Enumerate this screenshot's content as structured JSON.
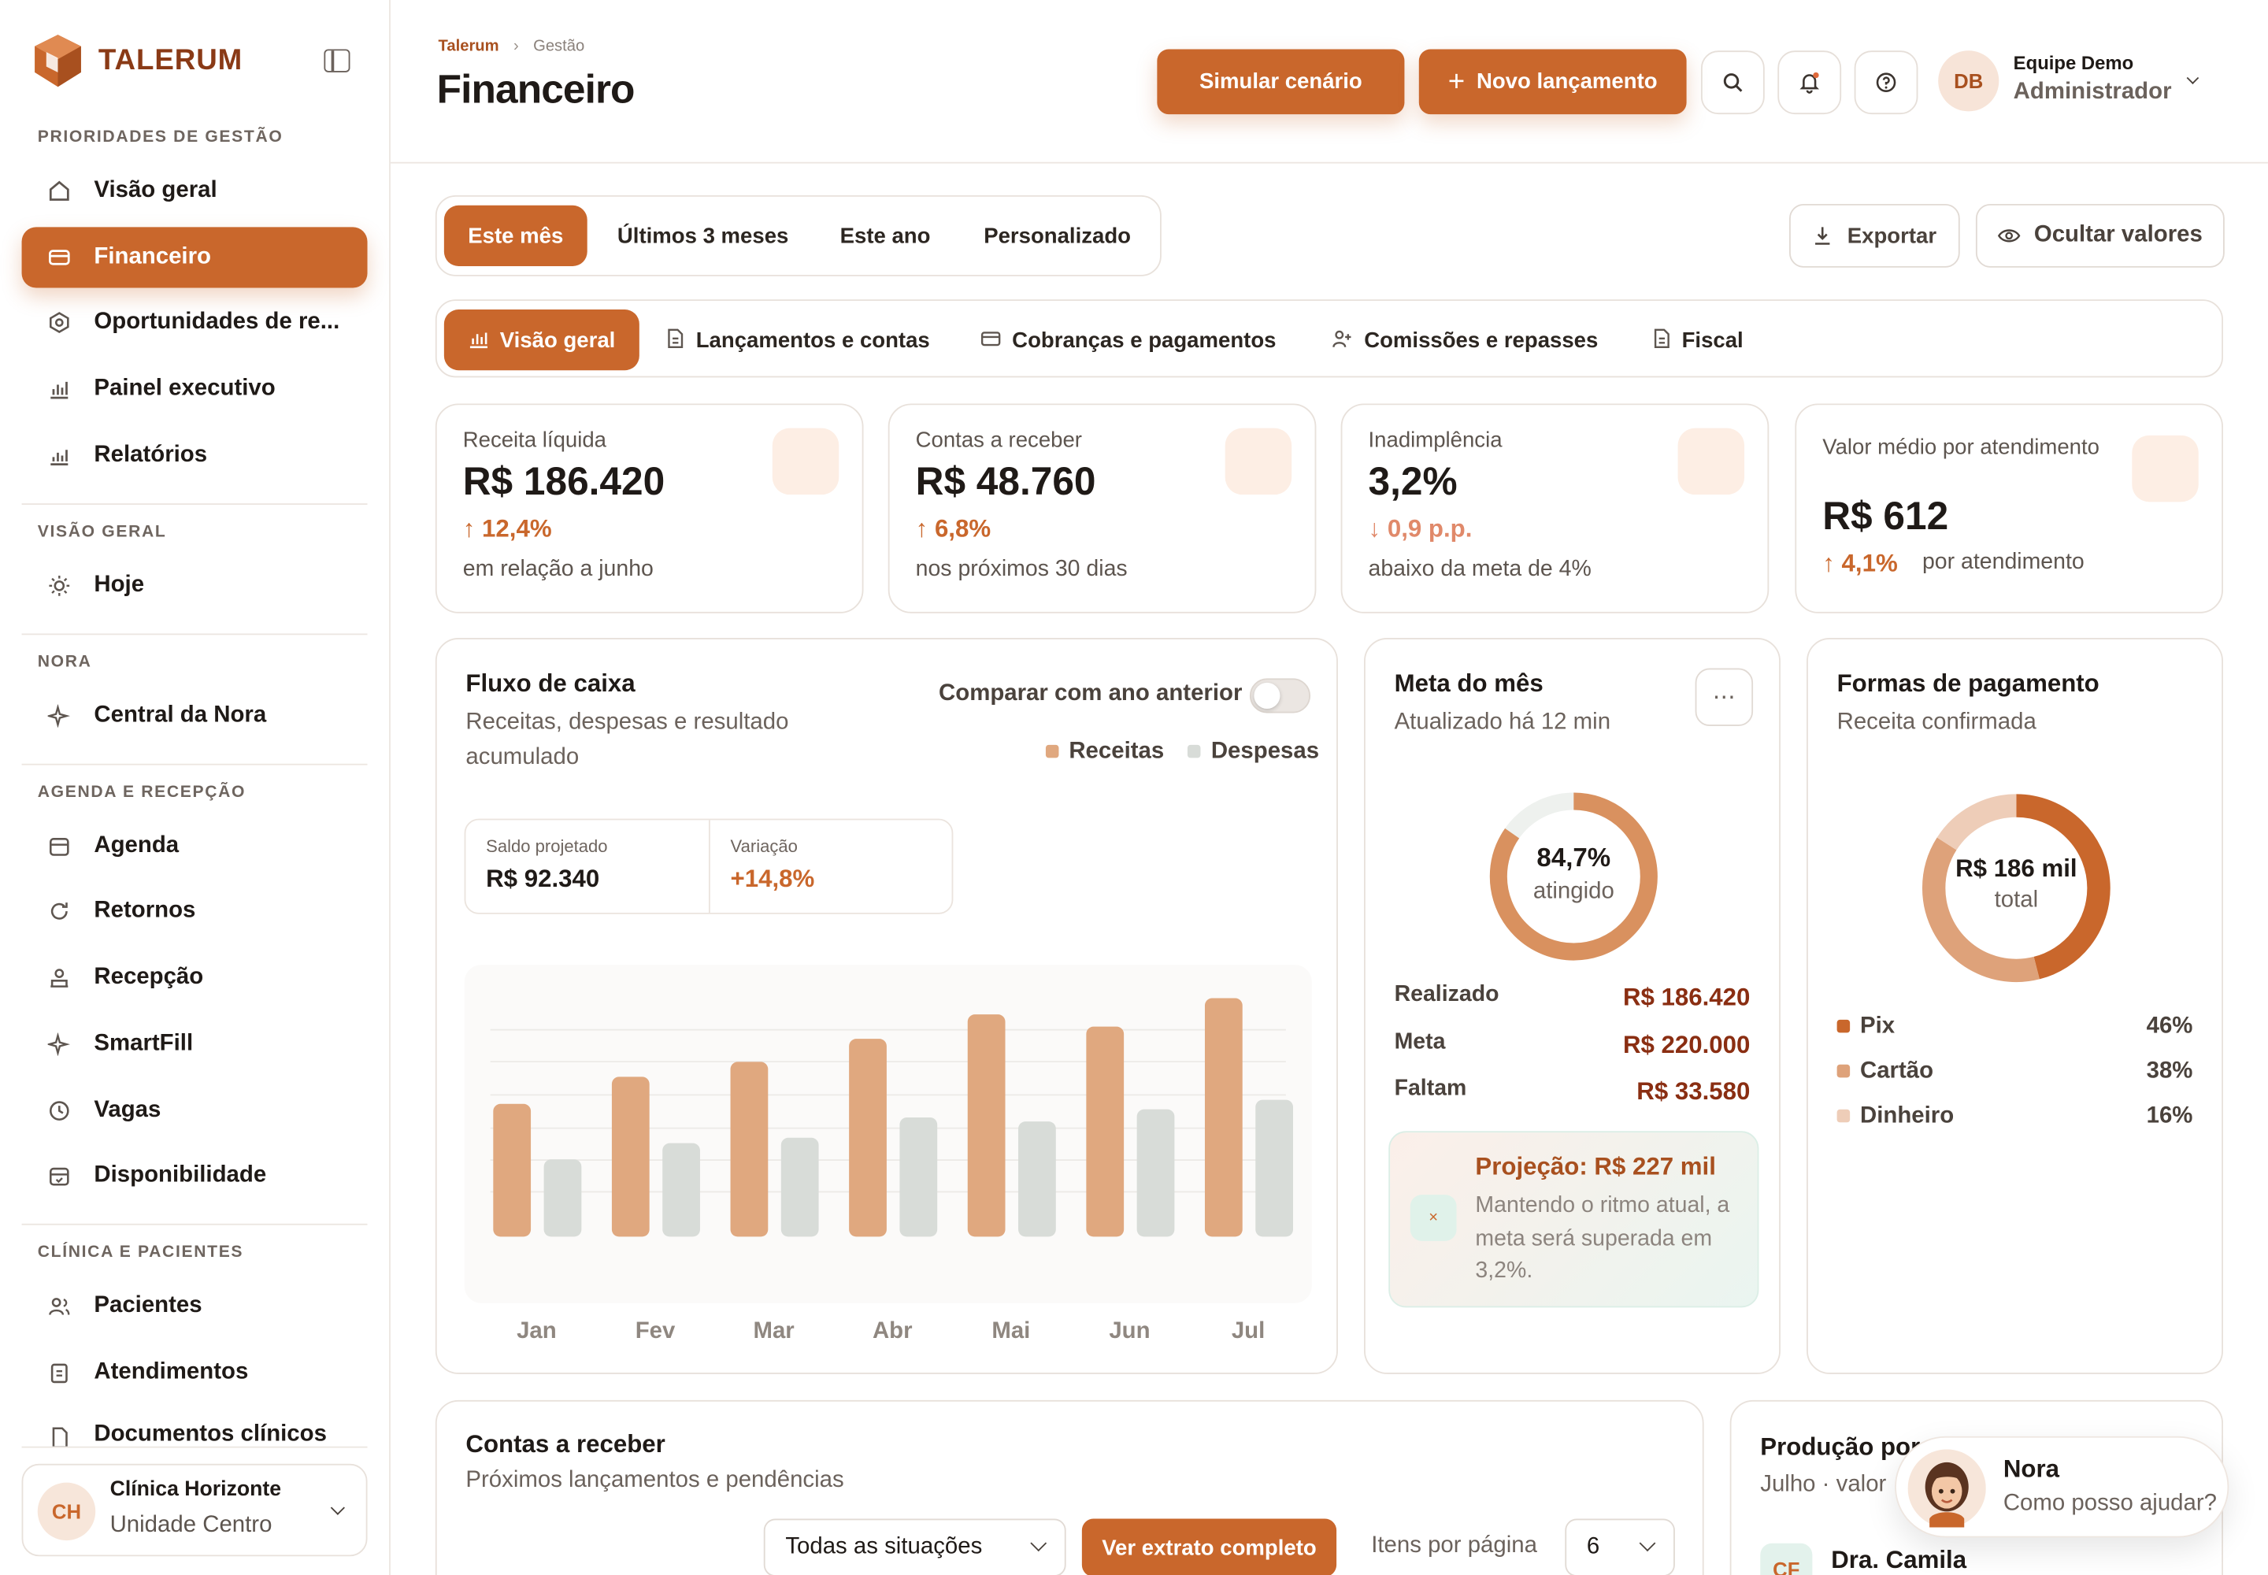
{
  "app": {
    "brand": "TALERUM"
  },
  "sidebar": {
    "sections": [
      {
        "title": "PRIORIDADES DE GESTÃO"
      },
      {
        "title": "VISÃO GERAL"
      },
      {
        "title": "NORA"
      },
      {
        "title": "AGENDA E RECEPÇÃO"
      },
      {
        "title": "CLÍNICA E PACIENTES"
      }
    ],
    "items": [
      {
        "label": "Visão geral",
        "icon": "home-icon"
      },
      {
        "label": "Financeiro",
        "icon": "wallet-icon"
      },
      {
        "label": "Oportunidades de re...",
        "icon": "target-icon"
      },
      {
        "label": "Painel executivo",
        "icon": "bar-chart-icon"
      },
      {
        "label": "Relatórios",
        "icon": "report-chart-icon"
      },
      {
        "label": "Hoje",
        "icon": "sun-icon"
      },
      {
        "label": "Central da Nora",
        "icon": "sparkle-icon"
      },
      {
        "label": "Agenda",
        "icon": "calendar-icon"
      },
      {
        "label": "Retornos",
        "icon": "refresh-icon"
      },
      {
        "label": "Recepção",
        "icon": "reception-icon"
      },
      {
        "label": "SmartFill",
        "icon": "sparkle-icon"
      },
      {
        "label": "Vagas",
        "icon": "clock-icon"
      },
      {
        "label": "Disponibilidade",
        "icon": "calendar-check-icon"
      },
      {
        "label": "Pacientes",
        "icon": "users-icon"
      },
      {
        "label": "Atendimentos",
        "icon": "clipboard-icon"
      },
      {
        "label": "Documentos clínicos",
        "icon": "document-icon"
      }
    ],
    "clinic": {
      "initials": "CH",
      "name": "Clínica Horizonte",
      "unit": "Unidade Centro"
    }
  },
  "header": {
    "breadcrumb": [
      "Talerum",
      "Gestão"
    ],
    "title": "Financeiro",
    "simulate_label": "Simular cenário",
    "new_entry_label": "Novo lançamento",
    "user": {
      "initials": "DB",
      "name": "Equipe Demo",
      "role": "Administrador"
    }
  },
  "period_tabs": [
    "Este mês",
    "Últimos 3 meses",
    "Este ano",
    "Personalizado"
  ],
  "actions": {
    "export_label": "Exportar",
    "hide_values_label": "Ocultar valores"
  },
  "section_tabs": [
    "Visão geral",
    "Lançamentos e contas",
    "Cobranças e pagamentos",
    "Comissões e repasses",
    "Fiscal"
  ],
  "kpis": [
    {
      "label": "Receita líquida",
      "value": "R$ 186.420",
      "delta": "12,4%",
      "direction": "up",
      "sub": "em relação a junho"
    },
    {
      "label": "Contas a receber",
      "value": "R$ 48.760",
      "delta": "6,8%",
      "direction": "up",
      "sub": "nos próximos 30 dias"
    },
    {
      "label": "Inadimplência",
      "value": "3,2%",
      "delta": "0,9 p.p.",
      "direction": "down",
      "sub": "abaixo da meta de 4%"
    },
    {
      "label": "Valor médio por atendimento",
      "value": "R$ 612",
      "delta": "4,1%",
      "direction": "up",
      "sub": "por atendimento"
    }
  ],
  "cashflow": {
    "title": "Fluxo de caixa",
    "subtitle": "Receitas, despesas e resultado acumulado",
    "compare_label": "Comparar com ano anterior",
    "compare_on": false,
    "projected_label": "Saldo projetado",
    "projected_value": "R$ 92.340",
    "variation_label": "Variação",
    "variation_value": "+14,8%"
  },
  "chart_data": {
    "type": "bar",
    "categories": [
      "Jan",
      "Fev",
      "Mar",
      "Abr",
      "Mai",
      "Jun",
      "Jul"
    ],
    "series": [
      {
        "name": "Receitas",
        "color": "#e0a87f",
        "values": [
          98,
          118,
          129,
          146,
          164,
          155,
          176
        ]
      },
      {
        "name": "Despesas",
        "color": "#d8dcd8",
        "values": [
          57,
          69,
          73,
          88,
          85,
          94,
          101
        ]
      }
    ],
    "ylim": [
      0,
      190
    ],
    "grid": true,
    "legend": "top-right"
  },
  "goal": {
    "title": "Meta do mês",
    "subtitle": "Atualizado há 12 min",
    "percent_label": "84,7%",
    "percent": 0.847,
    "caption": "atingido",
    "rows": [
      {
        "label": "Realizado",
        "value": "R$ 186.420"
      },
      {
        "label": "Meta",
        "value": "R$ 220.000"
      },
      {
        "label": "Faltam",
        "value": "R$ 33.580"
      }
    ],
    "projection_title": "Projeção: R$ 227 mil",
    "projection_text": "Mantendo o ritmo atual, a meta será superada em 3,2%."
  },
  "payments": {
    "title": "Formas de pagamento",
    "subtitle": "Receita confirmada",
    "total_value": "R$ 186 mil",
    "total_caption": "total",
    "methods": [
      {
        "name": "Pix",
        "pct_label": "46%",
        "pct": 46,
        "color": "#c9672c"
      },
      {
        "name": "Cartão",
        "pct_label": "38%",
        "pct": 38,
        "color": "#dea27a"
      },
      {
        "name": "Dinheiro",
        "pct_label": "16%",
        "pct": 16,
        "color": "#eecdb8"
      }
    ]
  },
  "receivables": {
    "title": "Contas a receber",
    "subtitle": "Próximos lançamentos e pendências",
    "filter_value": "Todas as situações",
    "statement_label": "Ver extrato completo",
    "per_page_label": "Itens por página",
    "per_page_value": "6"
  },
  "production": {
    "title": "Produção por",
    "subtitle": "Julho · valor",
    "first_initials": "CF",
    "first_name": "Dra. Camila"
  },
  "nora": {
    "name": "Nora",
    "prompt": "Como posso ajudar?"
  }
}
